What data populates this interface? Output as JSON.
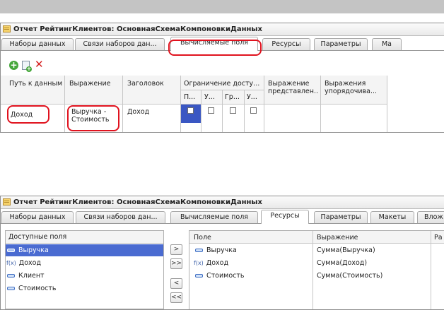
{
  "panel1": {
    "title": "Отчет РейтингКлиентов: ОсновнаяСхемаКомпоновкиДанных",
    "tabs": [
      "Наборы данных",
      "Связи наборов дан...",
      "Вычисляемые поля",
      "Ресурсы",
      "Параметры",
      "Ма"
    ],
    "active_tab": "Вычисляемые поля",
    "columns": {
      "path": "Путь к данным",
      "expression": "Выражение",
      "title": "Заголовок",
      "restriction": "Ограничение досту...",
      "restriction_sub": [
        "П...",
        "У...",
        "Гр...",
        "У..."
      ],
      "presentation": "Выражение представлен...",
      "ordering": "Выражения упорядочива..."
    },
    "row": {
      "path": "Доход",
      "expression": "Выручка - Стоимость",
      "title": "Доход"
    }
  },
  "panel2": {
    "title": "Отчет РейтингКлиентов: ОсновнаяСхемаКомпоновкиДанных",
    "tabs": [
      "Наборы данных",
      "Связи наборов дан...",
      "Вычисляемые поля",
      "Ресурсы",
      "Параметры",
      "Макеты",
      "Влож"
    ],
    "active_tab": "Ресурсы",
    "available_header": "Доступные поля",
    "available_fields": [
      {
        "icon": "field-icon",
        "label": "Выручка",
        "selected": true
      },
      {
        "icon": "calculated-field-icon",
        "label": "Доход",
        "selected": false
      },
      {
        "icon": "field-icon",
        "label": "Клиент",
        "selected": false
      },
      {
        "icon": "field-icon",
        "label": "Стоимость",
        "selected": false
      }
    ],
    "buttons": [
      ">",
      ">>",
      "<",
      "<<"
    ],
    "resources_columns": {
      "field": "Поле",
      "expression": "Выражение",
      "extra": "Ра"
    },
    "resources": [
      {
        "icon": "field-icon",
        "field": "Выручка",
        "expression": "Сумма(Выручка)"
      },
      {
        "icon": "calculated-field-icon",
        "field": "Доход",
        "expression": "Сумма(Доход)"
      },
      {
        "icon": "field-icon",
        "field": "Стоимость",
        "expression": "Сумма(Стоимость)"
      }
    ]
  },
  "icons": {
    "fx_glyph": "f(x)"
  },
  "colors": {
    "highlight": "#e0121e",
    "selection": "#4a6bd1"
  }
}
